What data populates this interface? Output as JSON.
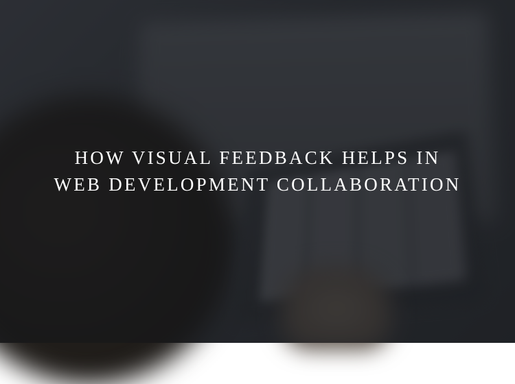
{
  "hero": {
    "title_line1": "How Visual Feedback Helps in",
    "title_line2": "Web Development Collaboration"
  }
}
